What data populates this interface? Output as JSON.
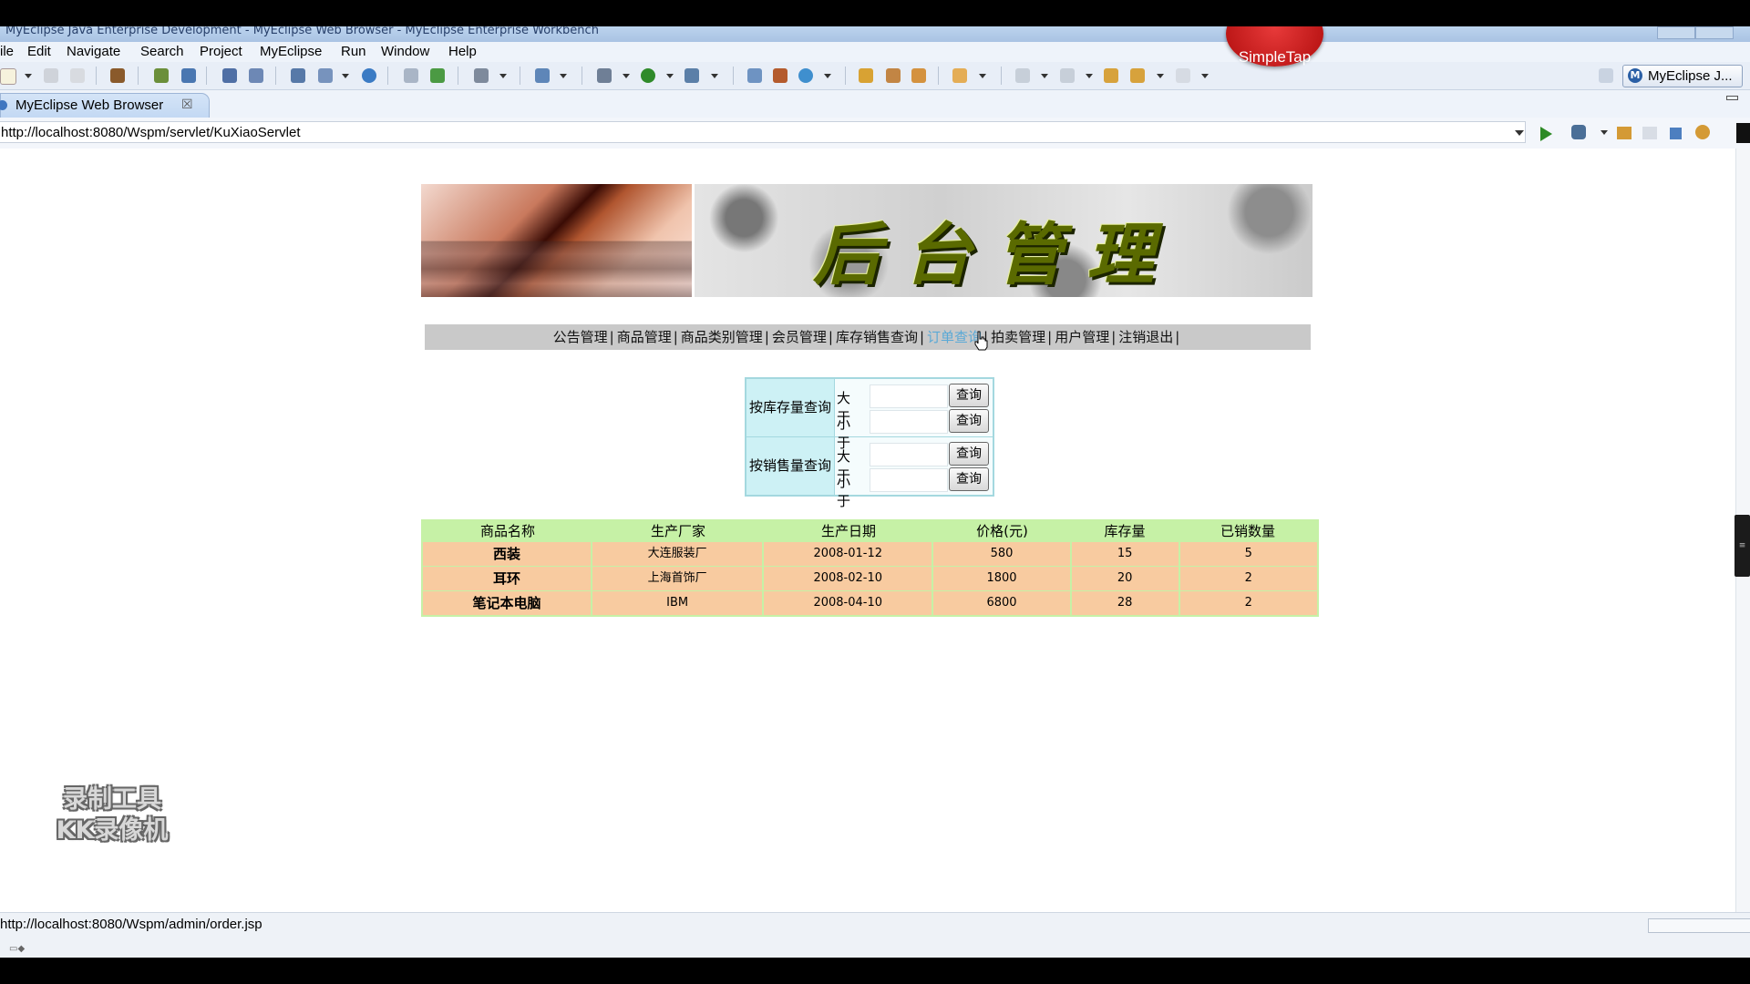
{
  "window": {
    "title": "MyEclipse Java Enterprise Development - MyEclipse Web Browser - MyEclipse Enterprise Workbench",
    "overlay_badge": "SimpleTap"
  },
  "menubar": [
    "ile",
    "Edit",
    "Navigate",
    "Search",
    "Project",
    "MyEclipse",
    "Run",
    "Window",
    "Help"
  ],
  "toolbar": {
    "perspective_label": "MyEclipse J...",
    "perspective_icon": "M"
  },
  "editor_tab": {
    "label": "MyEclipse Web Browser",
    "close": "☒"
  },
  "address_bar": {
    "url": "http://localhost:8080/Wspm/servlet/KuXiaoServlet"
  },
  "page": {
    "banner_title": "后台管理",
    "nav": [
      {
        "label": "公告管理"
      },
      {
        "label": "商品管理"
      },
      {
        "label": "商品类别管理"
      },
      {
        "label": "会员管理"
      },
      {
        "label": "库存销售查询"
      },
      {
        "label": "订单查询"
      },
      {
        "label": "拍卖管理"
      },
      {
        "label": "用户管理"
      },
      {
        "label": "注销退出"
      }
    ],
    "nav_separator": "|",
    "active_nav_index": 5,
    "query_form": {
      "stock_label": "按库存量查询",
      "sales_label": "按销售量查询",
      "greater": "大于",
      "less": "小于",
      "button": "查询"
    },
    "results": {
      "headers": [
        "商品名称",
        "生产厂家",
        "生产日期",
        "价格(元)",
        "库存量",
        "已销数量"
      ],
      "rows": [
        [
          "西装",
          "大连服装厂",
          "2008-01-12",
          "580",
          "15",
          "5"
        ],
        [
          "耳环",
          "上海首饰厂",
          "2008-02-10",
          "1800",
          "20",
          "2"
        ],
        [
          "笔记本电脑",
          "IBM",
          "2008-04-10",
          "6800",
          "28",
          "2"
        ]
      ]
    }
  },
  "watermark": {
    "line1": "录制工具",
    "line2": "KK录像机"
  },
  "status_bar": {
    "text": "http://localhost:8080/Wspm/admin/order.jsp"
  },
  "colors": {
    "nav_active": "#5aa9d6",
    "table_header_bg": "#c6f1a6",
    "table_row_bg": "#f8cba0",
    "query_label_bg": "#cdf1f5"
  }
}
